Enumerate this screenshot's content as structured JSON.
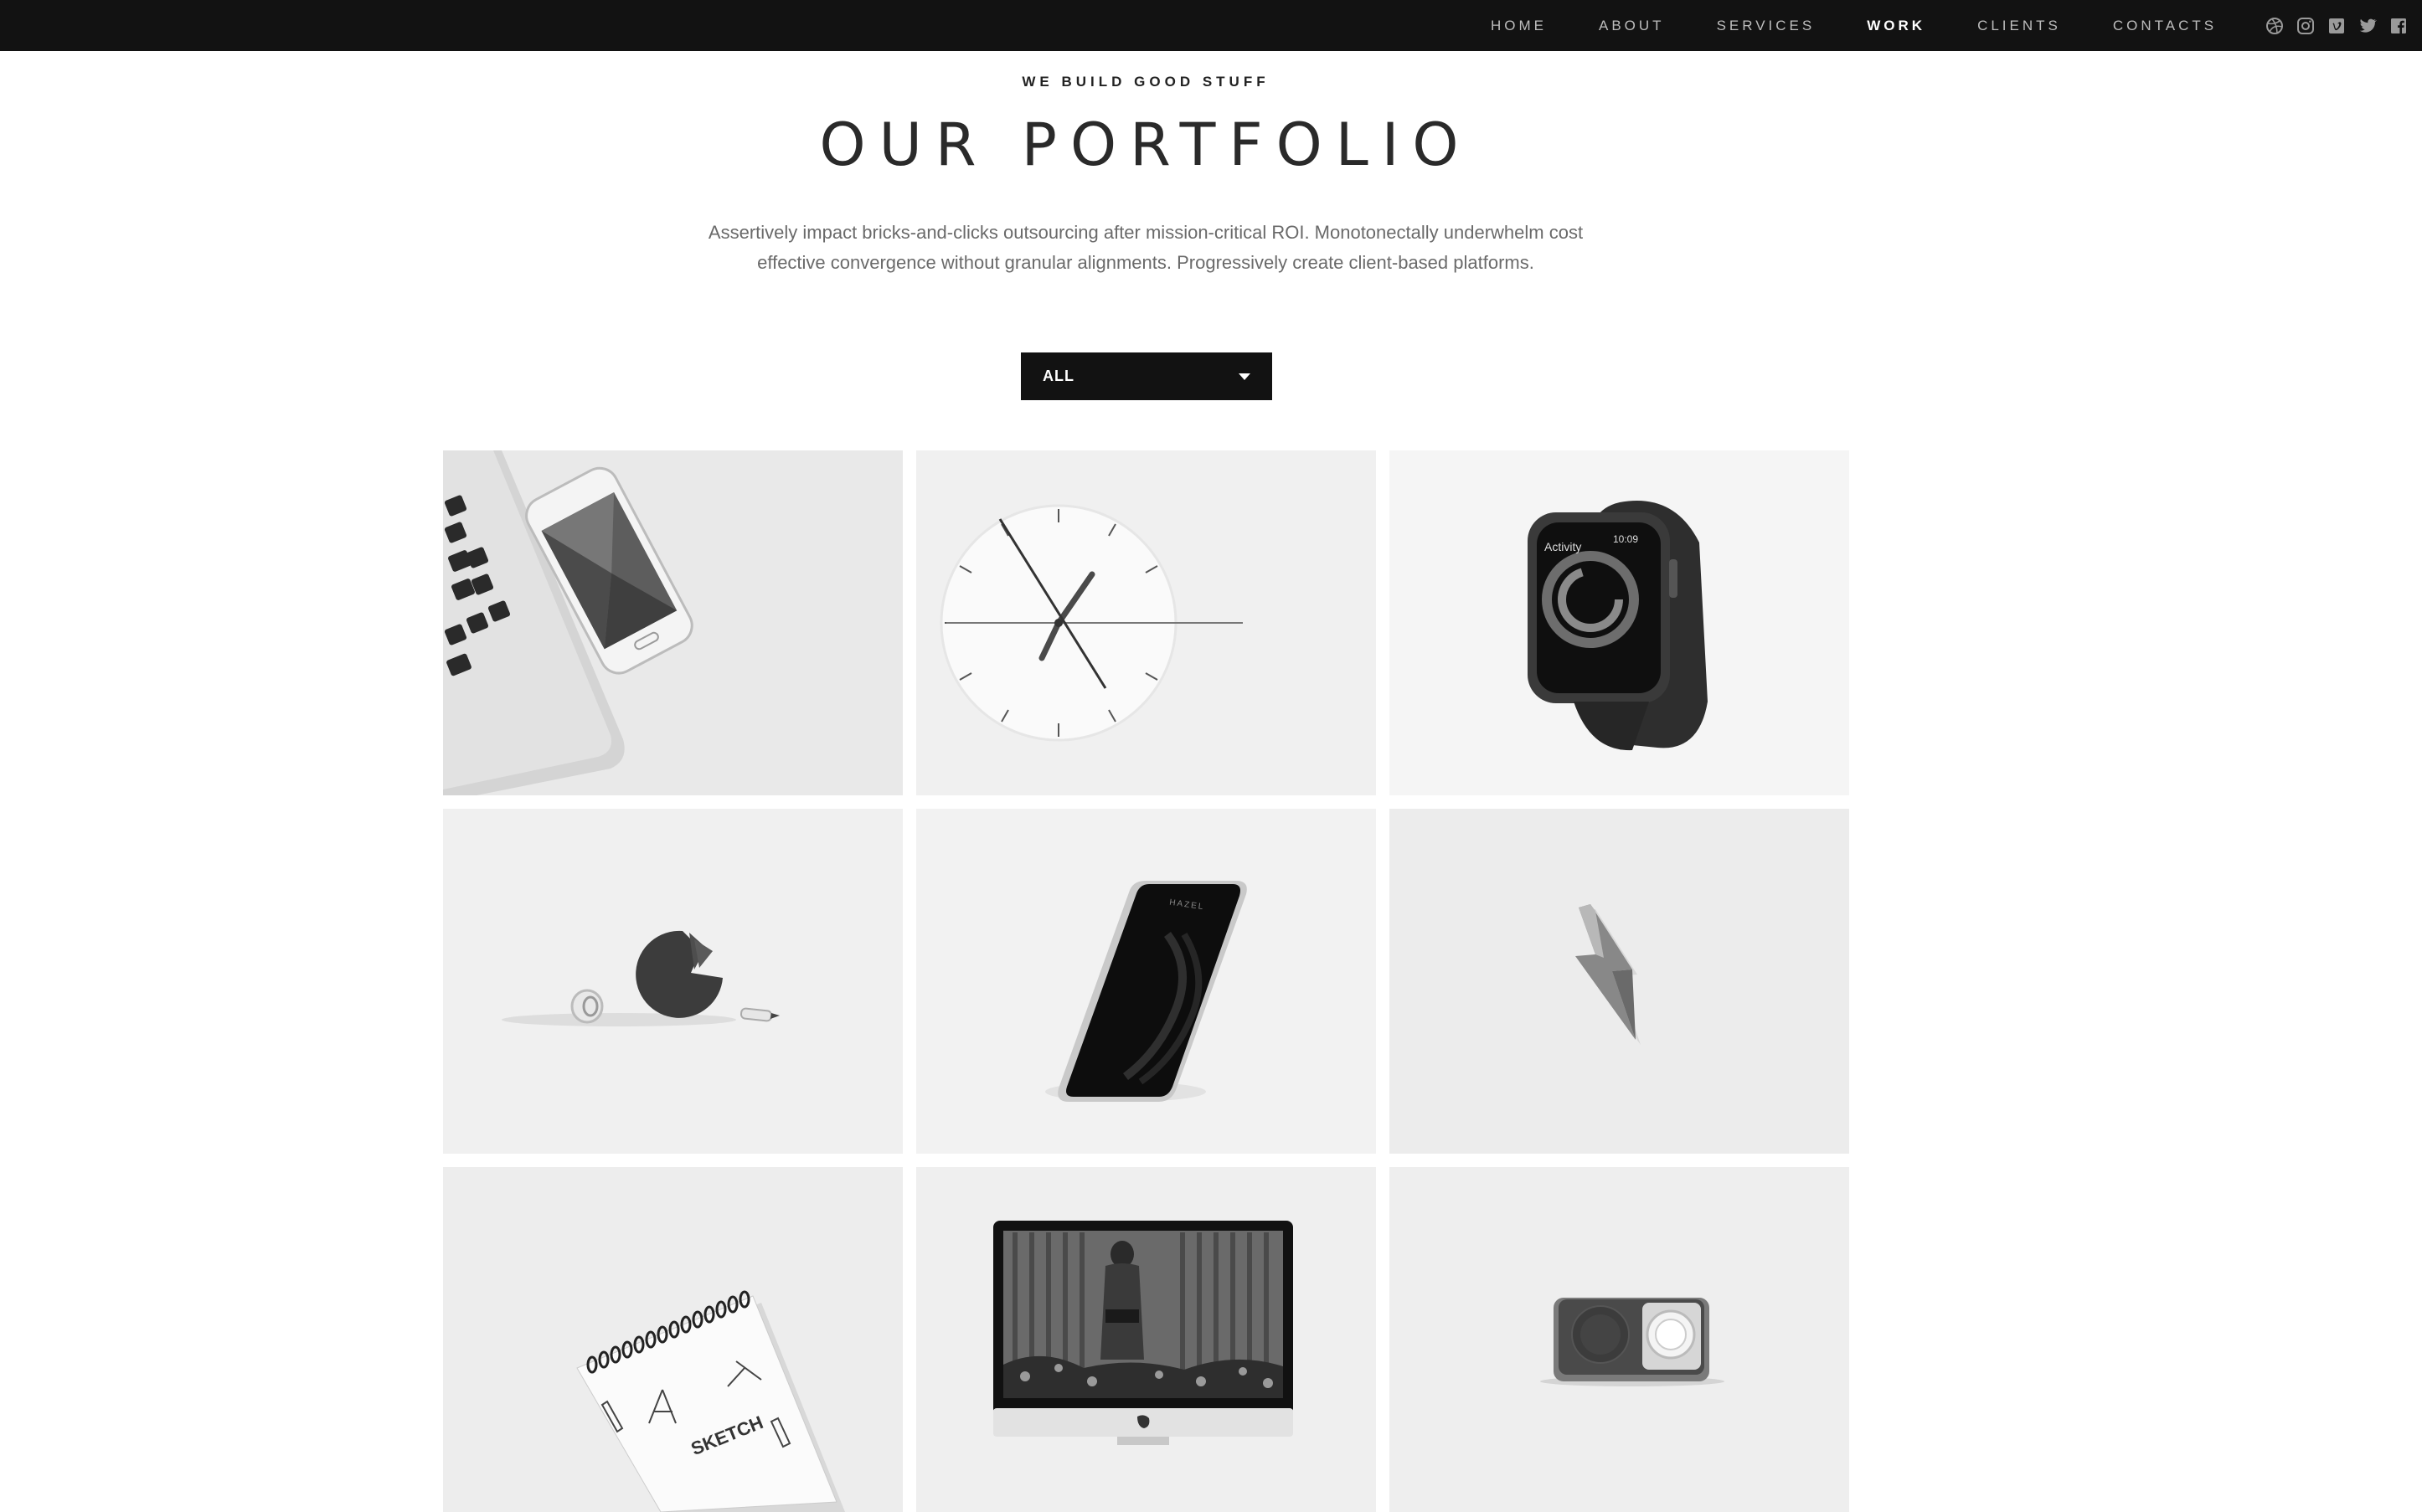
{
  "nav": {
    "items": [
      {
        "label": "HOME",
        "active": false
      },
      {
        "label": "ABOUT",
        "active": false
      },
      {
        "label": "SERVICES",
        "active": false
      },
      {
        "label": "WORK",
        "active": true
      },
      {
        "label": "CLIENTS",
        "active": false
      },
      {
        "label": "CONTACTS",
        "active": false
      }
    ],
    "social_icons": [
      "dribbble-icon",
      "instagram-icon",
      "vimeo-icon",
      "twitter-icon",
      "facebook-icon"
    ]
  },
  "header": {
    "eyebrow": "WE BUILD GOOD STUFF",
    "title": "OUR PORTFOLIO",
    "intro": "Assertively impact bricks-and-clicks outsourcing after mission-critical ROI. Monotonectally underwhelm cost effective convergence without granular alignments. Progressively create client-based platforms."
  },
  "filter": {
    "selected": "ALL"
  },
  "portfolio": {
    "items": [
      {
        "image": "laptop-and-phone"
      },
      {
        "image": "wall-clock"
      },
      {
        "image": "smartwatch",
        "watch_text": "Activity",
        "watch_time": "10:09"
      },
      {
        "image": "desk-objects"
      },
      {
        "image": "smartphone",
        "phone_text": "HAZEL"
      },
      {
        "image": "lightning-bolt"
      },
      {
        "image": "sketchbook",
        "book_text": "SKETCH"
      },
      {
        "image": "monitor"
      },
      {
        "image": "radio-speaker"
      }
    ]
  },
  "colors": {
    "topbar": "#121212",
    "nav_text": "#bdbdbd",
    "nav_active": "#ffffff",
    "filter_bg": "#121212"
  }
}
